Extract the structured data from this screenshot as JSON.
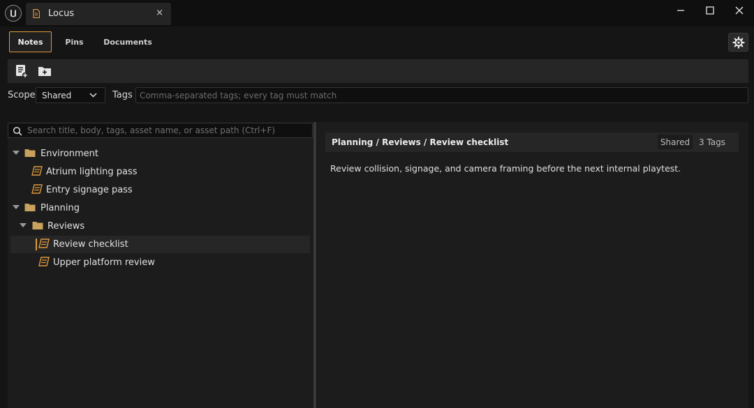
{
  "window": {
    "tab_title": "Locus",
    "close_glyph": "×",
    "controls": [
      "minimize-icon",
      "maximize-icon",
      "close-icon"
    ]
  },
  "modes": {
    "tabs": [
      {
        "label": "Notes",
        "active": true
      },
      {
        "label": "Pins",
        "active": false
      },
      {
        "label": "Documents",
        "active": false
      }
    ],
    "settings_icon": "gear-icon"
  },
  "toolbar": {
    "buttons": [
      {
        "icon": "new-note-icon"
      },
      {
        "icon": "new-folder-icon"
      }
    ]
  },
  "filters": {
    "scope_label": "Scope",
    "scope_value": "Shared",
    "tags_label": "Tags",
    "tags_placeholder": "Comma-separated tags; every tag must match"
  },
  "search": {
    "placeholder": "Search title, body, tags, asset name, or asset path (Ctrl+F)"
  },
  "tree": {
    "items": [
      {
        "label": "Environment",
        "type": "folder",
        "expanded": true
      },
      {
        "label": "Atrium lighting pass",
        "type": "note"
      },
      {
        "label": "Entry signage pass",
        "type": "note"
      },
      {
        "label": "Planning",
        "type": "folder",
        "expanded": true
      },
      {
        "label": "Reviews",
        "type": "folder",
        "expanded": true
      },
      {
        "label": "Review checklist",
        "type": "note",
        "selected": true
      },
      {
        "label": "Upper platform review",
        "type": "note"
      }
    ]
  },
  "note": {
    "path": "Planning / Reviews / Review checklist",
    "scope_badge": "Shared",
    "tags_count": "3 Tags",
    "body": "Review collision, signage, and camera framing before the next internal playtest."
  },
  "colors": {
    "accent": "#e09a3e",
    "folder": "#c9a25e",
    "background": "#151515",
    "panel": "#1c1c1c"
  }
}
